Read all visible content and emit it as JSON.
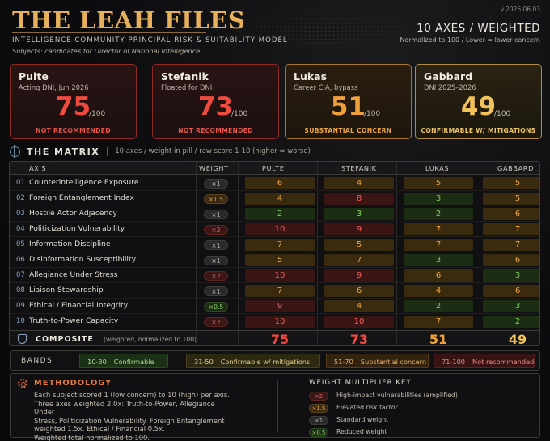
{
  "header": {
    "brand": "THE LEAH FILES",
    "subtitle": "INTELLIGENCE COMMUNITY PRINCIPAL RISK & SUITABILITY MODEL",
    "subjects_note": "Subjects: candidates for Director of National Intelligence",
    "version": "v.2026.06.03",
    "axes_title": "10 AXES / WEIGHTED",
    "axes_note": "Normalized to 100 / Lower = lower concern"
  },
  "cards": [
    {
      "name": "Pulte",
      "role": "Acting DNI, Jun 2026",
      "score": "75",
      "denom": "/100",
      "status": "NOT RECOMMENDED",
      "tone": "red",
      "score_color": "#ef4a3f",
      "status_color": "#e8564c"
    },
    {
      "name": "Stefanik",
      "role": "Floated for DNI",
      "score": "73",
      "denom": "/100",
      "status": "NOT RECOMMENDED",
      "tone": "red",
      "score_color": "#ef4a3f",
      "status_color": "#e8564c"
    },
    {
      "name": "Lukas",
      "role": "Career CIA, bypass",
      "score": "51",
      "denom": "/100",
      "status": "SUBSTANTIAL CONCERN",
      "tone": "amber",
      "score_color": "#f0a03a",
      "status_color": "#eea744"
    },
    {
      "name": "Gabbard",
      "role": "DNI 2025–2026",
      "score": "49",
      "denom": "/100",
      "status": "CONFIRMABLE W/ MITIGATIONS",
      "tone": "gold",
      "score_color": "#f2c25a",
      "status_color": "#ecc66a"
    }
  ],
  "matrix": {
    "title": "THE MATRIX",
    "note": "10 axes / weight in pill / raw score 1-10 (higher = worse)",
    "headers": {
      "axis": "AXIS",
      "weight": "WEIGHT",
      "subjects": [
        "PULTE",
        "STEFANIK",
        "LUKAS",
        "GABBARD"
      ]
    },
    "rows": [
      {
        "num": "01",
        "label": "Counterintelligence Exposure",
        "weight": "×1",
        "wclass": "w1",
        "scores": [
          {
            "v": "6",
            "c": "amb"
          },
          {
            "v": "4",
            "c": "amb"
          },
          {
            "v": "5",
            "c": "amb"
          },
          {
            "v": "5",
            "c": "amb"
          }
        ]
      },
      {
        "num": "02",
        "label": "Foreign Entanglement Index",
        "weight": "×1.5",
        "wclass": "w15",
        "scores": [
          {
            "v": "4",
            "c": "amb"
          },
          {
            "v": "8",
            "c": "red"
          },
          {
            "v": "3",
            "c": "grn"
          },
          {
            "v": "5",
            "c": "amb"
          }
        ]
      },
      {
        "num": "03",
        "label": "Hostile Actor Adjacency",
        "weight": "×1",
        "wclass": "w1",
        "scores": [
          {
            "v": "2",
            "c": "grn"
          },
          {
            "v": "3",
            "c": "grn"
          },
          {
            "v": "2",
            "c": "grn"
          },
          {
            "v": "6",
            "c": "amb"
          }
        ]
      },
      {
        "num": "04",
        "label": "Politicization Vulnerability",
        "weight": "×2",
        "wclass": "w2",
        "scores": [
          {
            "v": "10",
            "c": "red"
          },
          {
            "v": "9",
            "c": "red"
          },
          {
            "v": "7",
            "c": "amb"
          },
          {
            "v": "7",
            "c": "amb"
          }
        ]
      },
      {
        "num": "05",
        "label": "Information Discipline",
        "weight": "×1",
        "wclass": "w1",
        "scores": [
          {
            "v": "7",
            "c": "amb"
          },
          {
            "v": "5",
            "c": "amb"
          },
          {
            "v": "7",
            "c": "amb"
          },
          {
            "v": "7",
            "c": "amb"
          }
        ]
      },
      {
        "num": "06",
        "label": "Disinformation Susceptibility",
        "weight": "×1",
        "wclass": "w1",
        "scores": [
          {
            "v": "5",
            "c": "amb"
          },
          {
            "v": "7",
            "c": "amb"
          },
          {
            "v": "3",
            "c": "grn"
          },
          {
            "v": "6",
            "c": "amb"
          }
        ]
      },
      {
        "num": "07",
        "label": "Allegiance Under Stress",
        "weight": "×2",
        "wclass": "w2",
        "scores": [
          {
            "v": "10",
            "c": "red"
          },
          {
            "v": "9",
            "c": "red"
          },
          {
            "v": "6",
            "c": "amb"
          },
          {
            "v": "3",
            "c": "grn"
          }
        ]
      },
      {
        "num": "08",
        "label": "Liaison Stewardship",
        "weight": "×1",
        "wclass": "w1",
        "scores": [
          {
            "v": "7",
            "c": "amb"
          },
          {
            "v": "6",
            "c": "amb"
          },
          {
            "v": "4",
            "c": "amb"
          },
          {
            "v": "6",
            "c": "amb"
          }
        ]
      },
      {
        "num": "09",
        "label": "Ethical / Financial Integrity",
        "weight": "×0.5",
        "wclass": "w05",
        "scores": [
          {
            "v": "9",
            "c": "red"
          },
          {
            "v": "4",
            "c": "amb"
          },
          {
            "v": "2",
            "c": "grn"
          },
          {
            "v": "3",
            "c": "grn"
          }
        ]
      },
      {
        "num": "10",
        "label": "Truth-to-Power Capacity",
        "weight": "×2",
        "wclass": "w2",
        "scores": [
          {
            "v": "10",
            "c": "red"
          },
          {
            "v": "10",
            "c": "red"
          },
          {
            "v": "7",
            "c": "amb"
          },
          {
            "v": "2",
            "c": "grn"
          }
        ]
      }
    ],
    "composite": {
      "label": "COMPOSITE",
      "note": "(weighted, normalized to 100)",
      "values": [
        {
          "v": "75",
          "color": "#ef4a3f"
        },
        {
          "v": "73",
          "color": "#ef4a3f"
        },
        {
          "v": "51",
          "color": "#f0a03a"
        },
        {
          "v": "49",
          "color": "#f2c25a"
        }
      ]
    }
  },
  "bands": {
    "label": "BANDS",
    "items": [
      {
        "range": "10-30",
        "text": "Confirmable",
        "cls": "b-grn"
      },
      {
        "range": "31-50",
        "text": "Confirmable w/ mitigations",
        "cls": "b-gold"
      },
      {
        "range": "51-70",
        "text": "Substantial concern",
        "cls": "b-amb"
      },
      {
        "range": "71-100",
        "text": "Not recommended",
        "cls": "b-red"
      }
    ]
  },
  "methodology": {
    "title": "METHODOLOGY",
    "lines": [
      "Each subject scored 1 (low concern) to 10 (high) per axis.",
      "Three axes weighted 2.0x: Truth-to-Power, Allegiance Under",
      "Stress, Politicization Vulnerability. Foreign Entanglement",
      "weighted 1.5x. Ethical / Financial 0.5x.",
      "Weighted total normalized to 100."
    ]
  },
  "weight_key": {
    "title": "WEIGHT MULTIPLIER KEY",
    "items": [
      {
        "pill": "×2",
        "cls": "w2",
        "text": "High-impact vulnerabilities (amplified)"
      },
      {
        "pill": "×1.5",
        "cls": "w15",
        "text": "Elevated risk factor"
      },
      {
        "pill": "×1",
        "cls": "w1",
        "text": "Standard weight"
      },
      {
        "pill": "×0.5",
        "cls": "w05",
        "text": "Reduced weight"
      }
    ]
  }
}
